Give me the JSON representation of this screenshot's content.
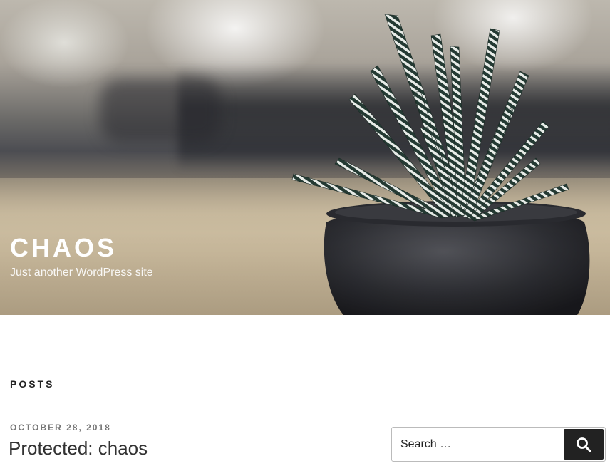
{
  "header": {
    "site_title": "CHAOS",
    "site_description": "Just another WordPress site"
  },
  "main": {
    "section_heading": "POSTS",
    "posts": [
      {
        "date": "OCTOBER 28, 2018",
        "title": "Protected: chaos"
      }
    ]
  },
  "search": {
    "placeholder": "Search …",
    "icon": "search-icon"
  },
  "colors": {
    "text_dark": "#222222",
    "meta_gray": "#767676",
    "button_bg": "#222222"
  }
}
